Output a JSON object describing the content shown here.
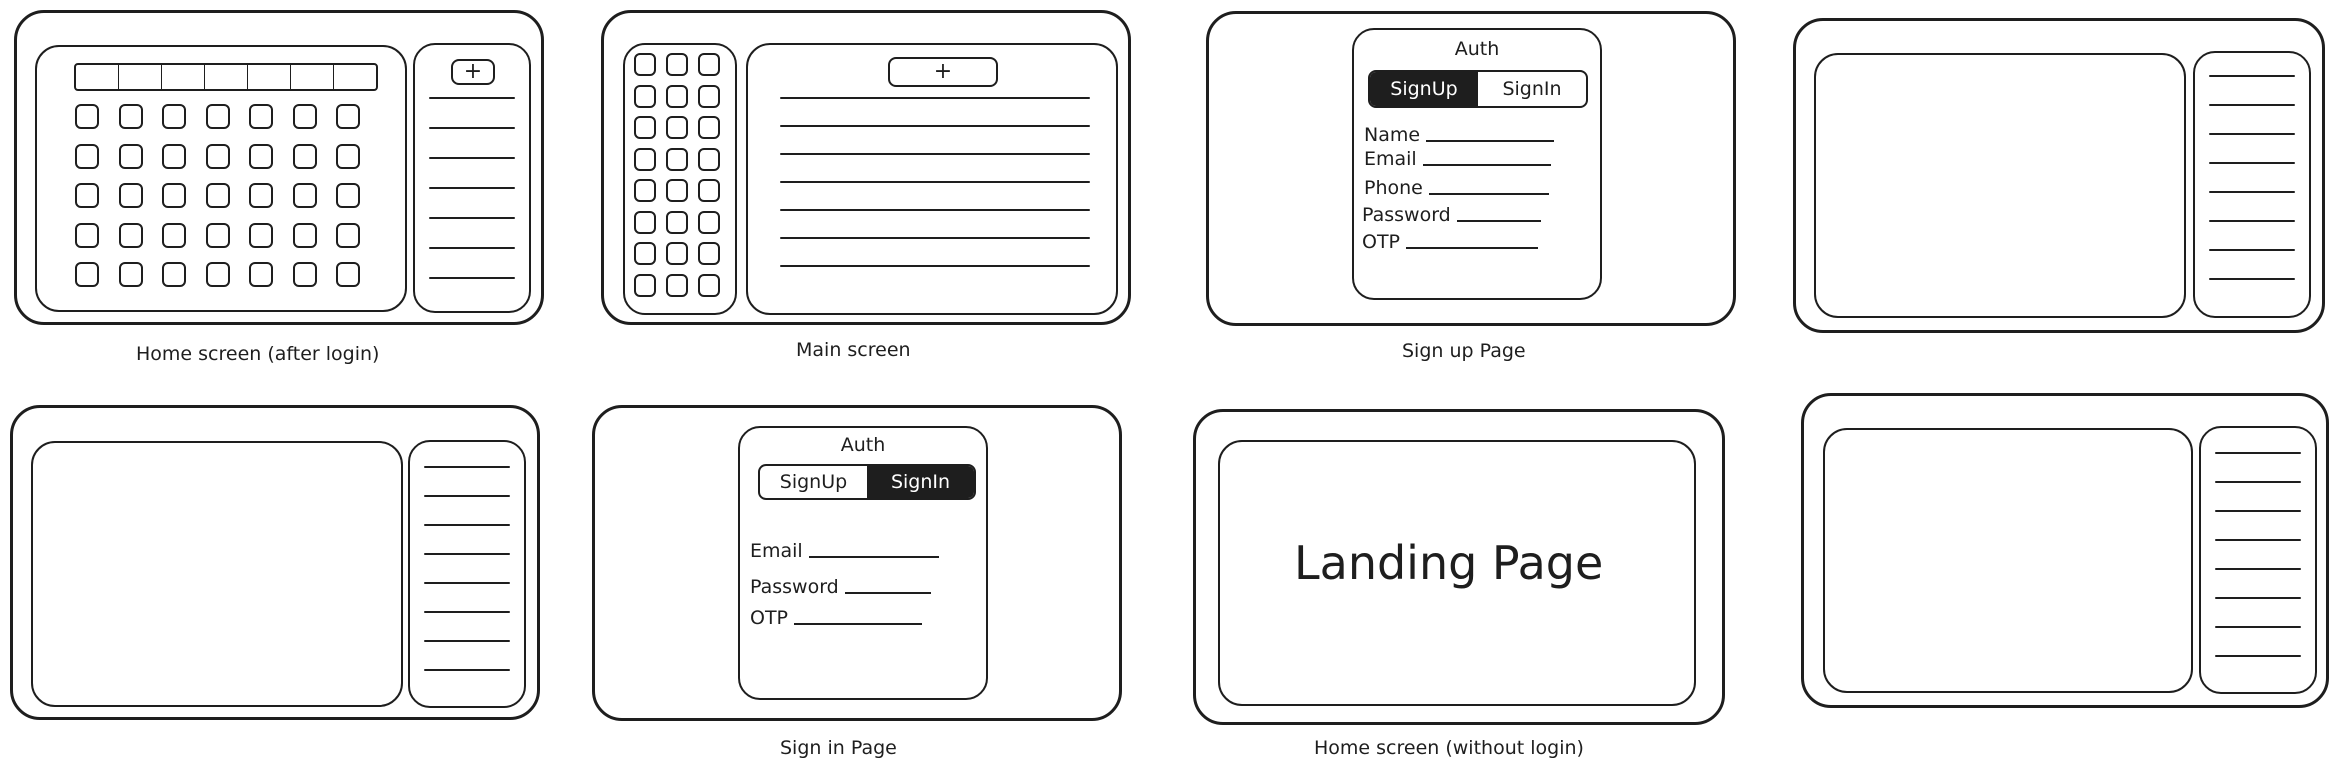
{
  "captions": {
    "home_after_login": "Home screen (after login)",
    "main_screen": "Main screen",
    "sign_up_page": "Sign up Page",
    "sign_in_page": "Sign in Page",
    "home_without_login": "Home screen (without login)"
  },
  "home_after_login": {
    "add_button": "+"
  },
  "main_screen": {
    "add_button": "+"
  },
  "sign_up": {
    "title": "Auth",
    "tab_signup": "SignUp",
    "tab_signin": "SignIn",
    "active_tab": "SignUp",
    "fields": [
      "Name",
      "Email",
      "Phone",
      "Password",
      "OTP"
    ]
  },
  "sign_in": {
    "title": "Auth",
    "tab_signup": "SignUp",
    "tab_signin": "SignIn",
    "active_tab": "SignIn",
    "fields": [
      "Email",
      "Password",
      "OTP"
    ]
  },
  "landing": {
    "text": "Landing Page"
  },
  "colors": {
    "stroke": "#1e1e1e",
    "background": "#ffffff"
  }
}
